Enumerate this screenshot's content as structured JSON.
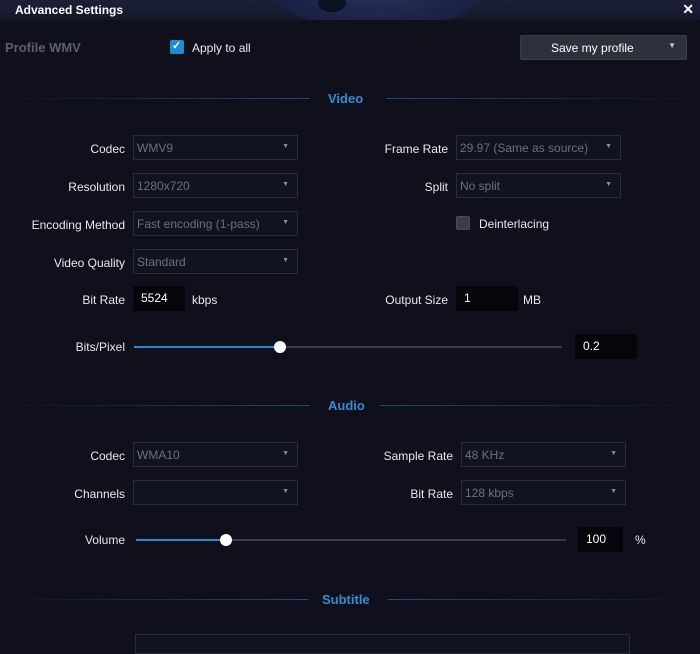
{
  "window": {
    "title": "Advanced Settings",
    "close_glyph": "✕"
  },
  "profile": {
    "label": "Profile WMV",
    "apply_to_all": "Apply to all",
    "apply_checked": true
  },
  "save_button": {
    "label": "Save my profile",
    "caret": "▼"
  },
  "video": {
    "title": "Video",
    "codec_label": "Codec",
    "codec_value": "WMV9",
    "frame_rate_label": "Frame Rate",
    "frame_rate_value": "29.97 (Same as source)",
    "resolution_label": "Resolution",
    "resolution_value": "1280x720",
    "split_label": "Split",
    "split_value": "No split",
    "encoding_label": "Encoding Method",
    "encoding_value": "Fast encoding (1-pass)",
    "deinterlacing_label": "Deinterlacing",
    "deinterlacing_checked": false,
    "quality_label": "Video Quality",
    "quality_value": "Standard",
    "bitrate_label": "Bit Rate",
    "bitrate_value": "5524",
    "bitrate_unit": "kbps",
    "output_size_label": "Output Size",
    "output_size_value": "1",
    "output_size_unit": "MB",
    "bits_pixel_label": "Bits/Pixel",
    "bits_pixel_value": "0.2",
    "bits_pixel_slider_fraction": 0.34
  },
  "audio": {
    "title": "Audio",
    "codec_label": "Codec",
    "codec_value": "WMA10",
    "sample_rate_label": "Sample Rate",
    "sample_rate_value": "48 KHz",
    "channels_label": "Channels",
    "channels_value": "",
    "bitrate_label": "Bit Rate",
    "bitrate_value": "128 kbps",
    "volume_label": "Volume",
    "volume_value": "100",
    "volume_unit": "%",
    "volume_slider_fraction": 0.21
  },
  "subtitle": {
    "title": "Subtitle"
  },
  "icons": {
    "dropdown": "▼",
    "check": "check-icon",
    "close": "close-icon"
  },
  "colors": {
    "accent": "#1f8ed0",
    "section_title": "#2f8fd6",
    "background": "#0f101b"
  }
}
